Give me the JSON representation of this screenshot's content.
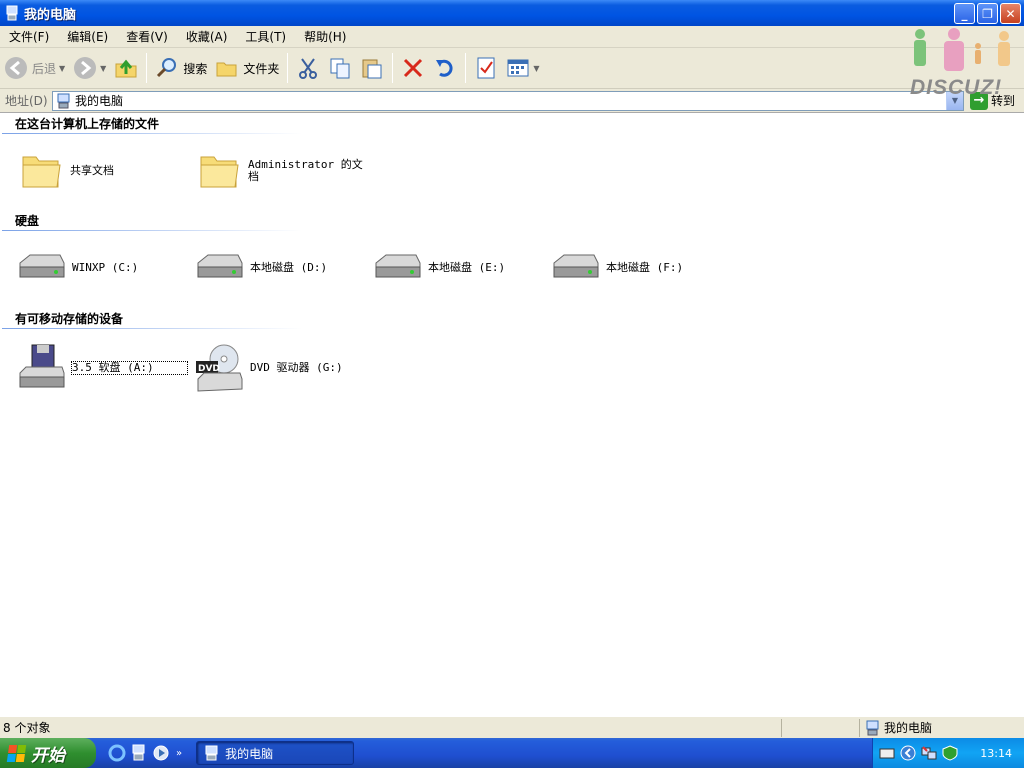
{
  "window": {
    "title": "我的电脑"
  },
  "menu": [
    "文件(F)",
    "编辑(E)",
    "查看(V)",
    "收藏(A)",
    "工具(T)",
    "帮助(H)"
  ],
  "toolbar": {
    "back": "后退",
    "search": "搜索",
    "folders": "文件夹"
  },
  "address": {
    "label": "地址(D)",
    "value": "我的电脑",
    "go": "转到"
  },
  "groups": [
    {
      "title": "在这台计算机上存储的文件",
      "items": [
        "共享文档",
        "Administrator 的文档"
      ]
    },
    {
      "title": "硬盘",
      "items": [
        "WINXP (C:)",
        "本地磁盘 (D:)",
        "本地磁盘 (E:)",
        "本地磁盘 (F:)"
      ]
    },
    {
      "title": "有可移动存储的设备",
      "items": [
        "3.5 软盘 (A:)",
        "DVD 驱动器 (G:)"
      ]
    }
  ],
  "status": {
    "count": "8 个对象",
    "location": "我的电脑"
  },
  "taskbar": {
    "start": "开始",
    "task": "我的电脑",
    "clock": "13:14"
  },
  "watermark": "DISCUZ!"
}
